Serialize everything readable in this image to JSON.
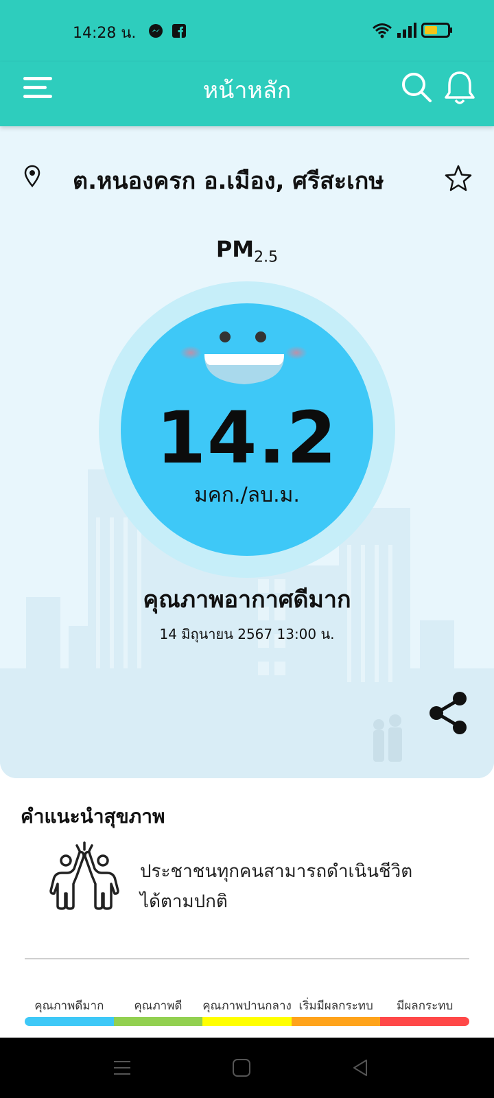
{
  "status_bar": {
    "time": "14:28 น.",
    "icons": [
      "messenger-icon",
      "facebook-icon",
      "wifi-icon",
      "signal-icon",
      "battery-icon"
    ]
  },
  "app_bar": {
    "title": "หน้าหลัก",
    "icons": [
      "menu-icon",
      "search-icon",
      "bell-icon"
    ]
  },
  "location": {
    "name": "ต.หนองครก อ.เมือง, ศรีสะเกษ"
  },
  "air_quality": {
    "pm_label": "PM",
    "pm_sub": "2.5",
    "value": "14.2",
    "unit": "มคก./ลบ.ม.",
    "level": "คุณภาพอากาศดีมาก",
    "datetime": "14 มิถุนายน 2567  13:00 น.",
    "color": "#3ec8f7"
  },
  "advice": {
    "title": "คำแนะนำสุขภาพ",
    "text": "ประชาชนทุกคนสามารถดำเนินชีวิตได้ตามปกติ"
  },
  "legend": [
    {
      "label": "คุณภาพดีมาก",
      "color": "#3ec8f7"
    },
    {
      "label": "คุณภาพดี",
      "color": "#92d050"
    },
    {
      "label": "คุณภาพปานกลาง",
      "color": "#ffff00"
    },
    {
      "label": "เริ่มมีผลกระทบ",
      "color": "#ffa31a"
    },
    {
      "label": "มีผลกระทบ",
      "color": "#ff4848"
    }
  ],
  "colors": {
    "primary": "#2ecdbd",
    "hero_bg": "#e8f6fc"
  }
}
